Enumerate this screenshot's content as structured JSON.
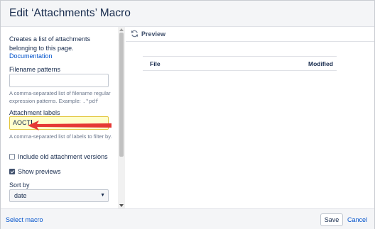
{
  "dialog": {
    "title": "Edit ‘Attachments’ Macro"
  },
  "sidebar": {
    "description": "Creates a list of attachments belonging to this page.",
    "documentation_link": "Documentation",
    "filename_patterns": {
      "label": "Filename patterns",
      "value": "",
      "help_prefix": "A comma-separated list of filename regular expression patterns. Example: ",
      "help_example": ".*pdf"
    },
    "attachment_labels": {
      "label": "Attachment labels",
      "value": "AOCT",
      "help": "A comma-separated list of labels to filter by."
    },
    "include_old_versions": {
      "label": "Include old attachment versions",
      "checked": false
    },
    "show_previews": {
      "label": "Show previews",
      "checked": true
    },
    "sort_by": {
      "label": "Sort by",
      "selected": "date"
    }
  },
  "preview": {
    "label": "Preview",
    "icon": "refresh-icon",
    "columns": [
      "File",
      "Modified"
    ]
  },
  "footer": {
    "select_macro": "Select macro",
    "save": "Save",
    "cancel": "Cancel"
  },
  "colors": {
    "link": "#0052cc",
    "highlight_input": "#ffffcc",
    "annotation_arrow": "#e53935"
  }
}
